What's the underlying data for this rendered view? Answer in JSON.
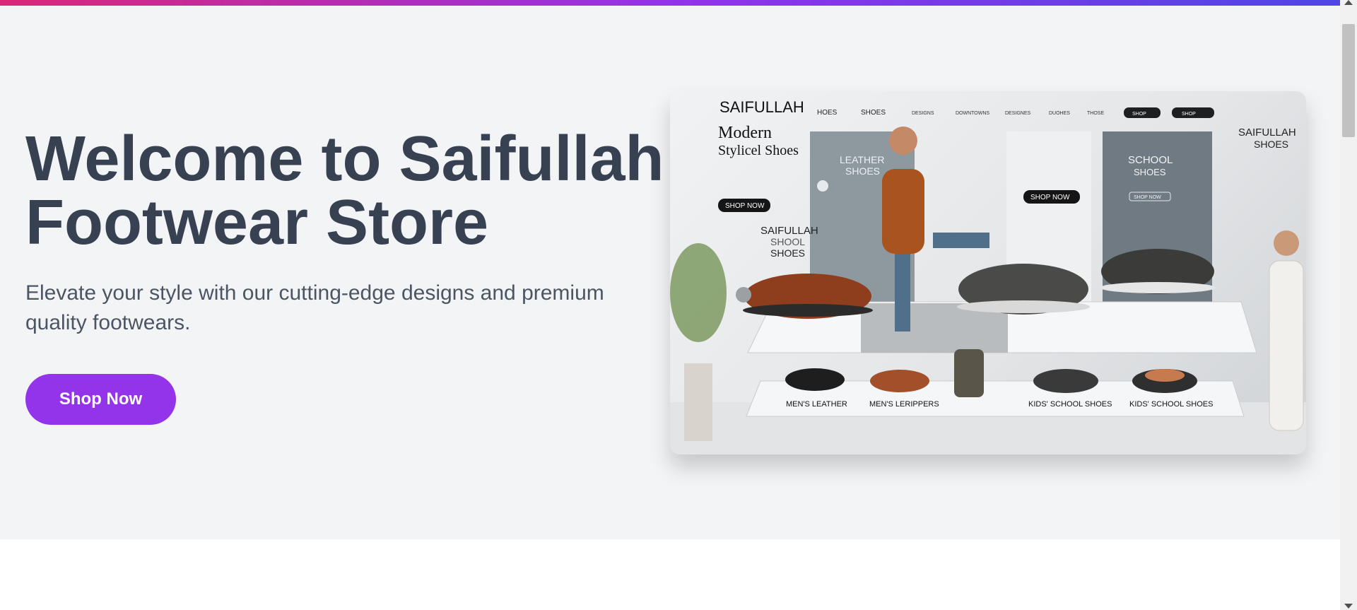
{
  "hero": {
    "title_line1": "Welcome to Saifullah",
    "title_line2": "Footwear Store",
    "subtitle": "Elevate your style with our cutting-edge designs and premium quality footwears.",
    "cta_label": "Shop Now"
  },
  "showcase": {
    "brand": "SAIFULLAH",
    "nav": [
      "HOES",
      "SHOES",
      "DESIGNS",
      "DOWNTOWNS",
      "DESIGNES",
      "DUOHES",
      "THOSE"
    ],
    "nav_pill_1": "SHOP",
    "nav_pill_2": "SHOP",
    "heading_line1": "Modern",
    "heading_line2": "Stylicel Shoes",
    "shop_now": "SHOP NOW",
    "leather_line1": "LEATHER",
    "leather_line2": "SHOES",
    "school_line1": "SCHOOL",
    "school_line2": "SHOES",
    "saif_school_line1": "SAIFULLAH",
    "saif_school_line2": "SHOOL",
    "saif_school_line3": "SHOES",
    "right_brand_line1": "SAIFULLAH",
    "right_brand_line2": "SHOES",
    "panel_shop_now": "SHOP NOW",
    "panel_small_btn": "SHOP NOW",
    "labels": [
      "MEN'S LEATHER",
      "MEN'S LERIPPERS",
      "KIDS' SCHOOL SHOES",
      "KIDS' SCHOOL SHOES"
    ]
  },
  "colors": {
    "accent": "#9333ea",
    "title": "#374151",
    "subtitle": "#4b5563",
    "hero_bg": "#f3f4f6",
    "gradient": [
      "#db2777",
      "#9333ea",
      "#4f46e5"
    ]
  }
}
